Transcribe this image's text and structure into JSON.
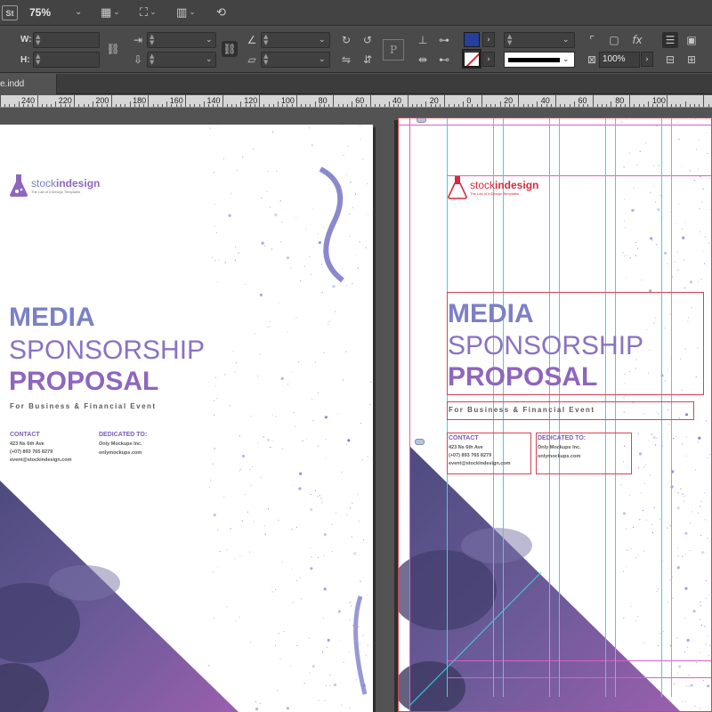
{
  "app": {
    "logo_text": "St",
    "zoom": "75%"
  },
  "toolbar": {
    "w_label": "W:",
    "h_label": "H:",
    "scale_percent": "100%",
    "fill_color": "#24409a",
    "stroke_color": "none"
  },
  "document": {
    "tab_label": "e.indd"
  },
  "ruler": {
    "labels": [
      "240",
      "220",
      "200",
      "180",
      "160",
      "140",
      "120",
      "100",
      "80",
      "60",
      "40",
      "20",
      "0",
      "20",
      "40",
      "60",
      "80",
      "100"
    ]
  },
  "spread": {
    "logo": {
      "stock": "stock",
      "indesign": "indesign",
      "tagline": "The Lab of InDesign Templates"
    },
    "title_line1": "MEDIA",
    "title_line2": "SPONSORSHIP",
    "title_line3": "PROPOSAL",
    "subtitle": "For Business & Financial Event",
    "contact": {
      "heading": "CONTACT",
      "address": "423 Ns 6th Ave",
      "phone": "(+07) 893 765 8279",
      "email": "event@stockindesign.com"
    },
    "dedicated": {
      "heading": "DEDICATED TO:",
      "company": "Only Mockups Inc.",
      "website": "onlymockups.com"
    }
  },
  "colors": {
    "accent_blue": "#7b80c7",
    "accent_purple": "#8e66bd",
    "guide_cyan": "#39d4e0",
    "guide_magenta": "#d860c9",
    "frame_red": "#d94157"
  }
}
